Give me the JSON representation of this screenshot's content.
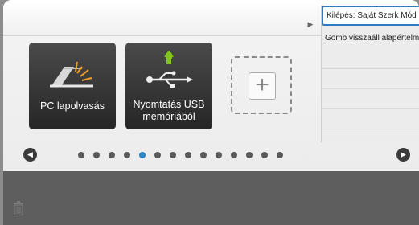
{
  "tiles": [
    {
      "label": "PC lapolvasás",
      "icon": "scanner-icon"
    },
    {
      "label": "Nyomtatás USB\nmemóriából",
      "icon": "usb-icon"
    }
  ],
  "add_tile": {
    "symbol": "+",
    "icon": "add-icon"
  },
  "pager": {
    "dot_count": 14,
    "active_index": 4,
    "active_color": "#2b86c6",
    "prev_glyph": "◀",
    "next_glyph": "▶"
  },
  "action_menu": {
    "toggle_glyph": "▶",
    "items": [
      {
        "label": "Kilépés: Saját Szerk Mód"
      },
      {
        "label": "Gomb visszaáll alapértelm"
      }
    ]
  },
  "trash": {
    "icon": "trash-icon"
  }
}
